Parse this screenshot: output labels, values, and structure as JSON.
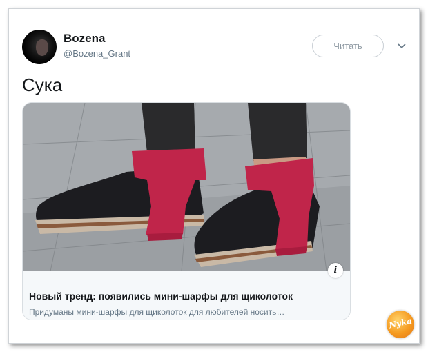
{
  "tweet": {
    "author_name": "Bozena",
    "author_handle": "@Bozena_Grant",
    "follow_label": "Читать",
    "text": "Сука"
  },
  "card": {
    "title": "Новый тренд: появились мини-шарфы для щиколоток",
    "description": "Придуманы мини-шарфы для щиколоток для любителей носить…",
    "info_icon_label": "i"
  },
  "watermark": {
    "text": "Nyka"
  },
  "icons": {
    "avatar": "avatar-photo",
    "menu": "chevron-down-icon",
    "info": "info-icon"
  },
  "colors": {
    "text_primary": "#14171a",
    "text_secondary": "#657786",
    "scarf": "#c0254a",
    "card_footer_bg": "#f5f8fa"
  }
}
